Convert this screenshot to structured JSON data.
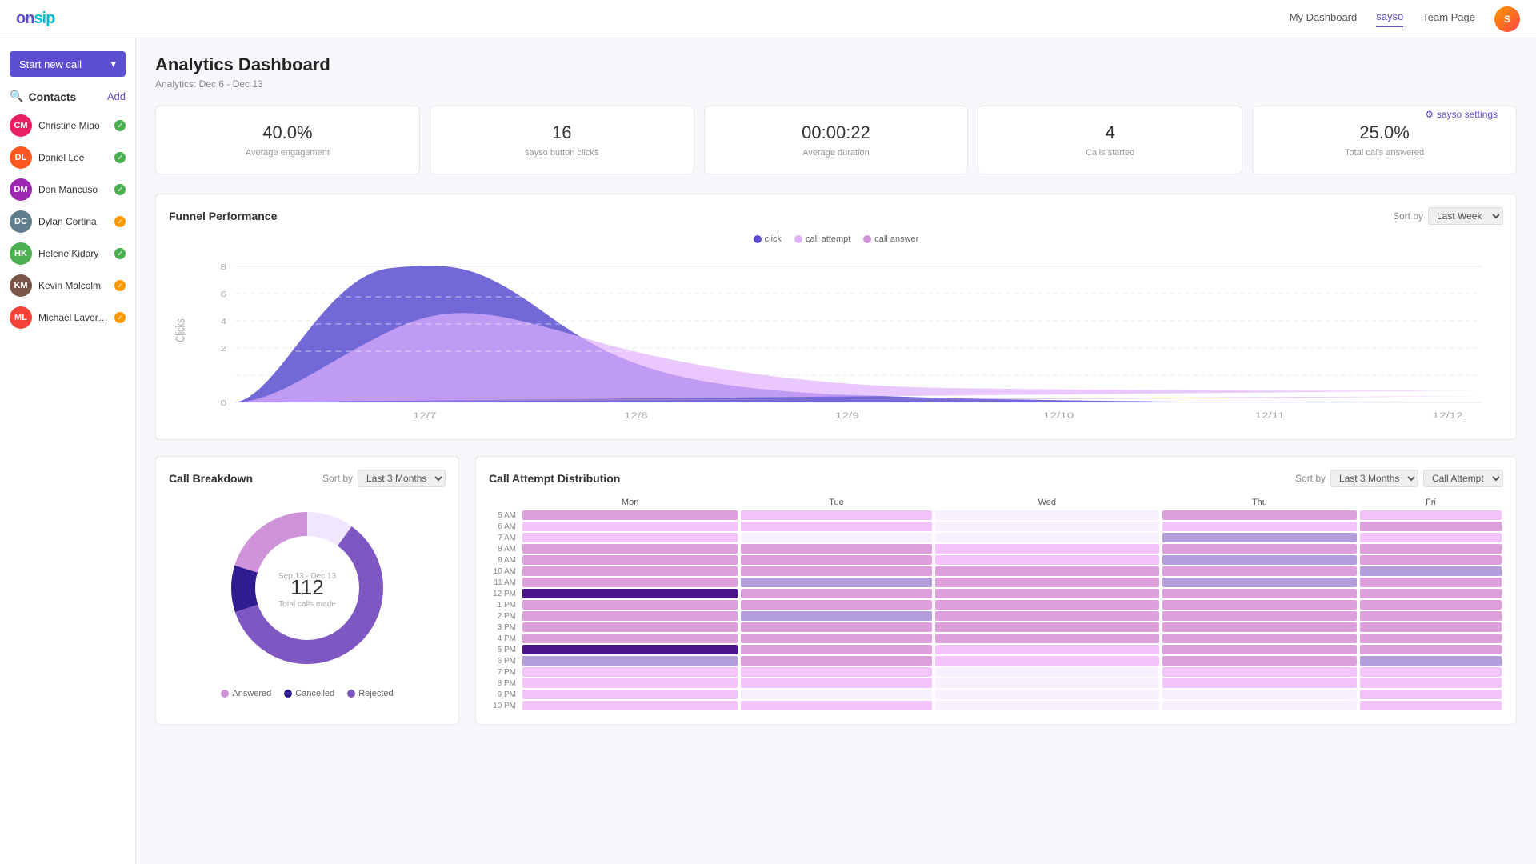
{
  "nav": {
    "logo": "onsip",
    "links": [
      {
        "label": "My Dashboard",
        "active": false
      },
      {
        "label": "sayso",
        "active": true
      },
      {
        "label": "Team Page",
        "active": false
      }
    ],
    "avatar_initials": "S"
  },
  "sidebar": {
    "start_call": "Start new call",
    "contacts_label": "Contacts",
    "add_label": "Add",
    "contacts": [
      {
        "name": "Christine Miao",
        "color": "#e91e63",
        "status": "green"
      },
      {
        "name": "Daniel Lee",
        "color": "#ff5722",
        "status": "green"
      },
      {
        "name": "Don Mancuso",
        "color": "#9c27b0",
        "status": "green"
      },
      {
        "name": "Dylan Cortina",
        "color": "#607d8b",
        "status": "orange"
      },
      {
        "name": "Helene Kidary",
        "color": "#4caf50",
        "status": "green"
      },
      {
        "name": "Kevin Malcolm",
        "color": "#795548",
        "status": "orange"
      },
      {
        "name": "Michael Lavorgna",
        "color": "#f44336",
        "status": "orange"
      }
    ]
  },
  "header": {
    "title": "Analytics Dashboard",
    "subtitle": "Analytics: Dec 6 - Dec 13",
    "settings_label": "sayso settings"
  },
  "stats": [
    {
      "value": "40.0%",
      "label": "Average engagement"
    },
    {
      "value": "16",
      "label": "sayso button clicks"
    },
    {
      "value": "00:00:22",
      "label": "Average duration"
    },
    {
      "value": "4",
      "label": "Calls started"
    },
    {
      "value": "25.0%",
      "label": "Total calls answered"
    }
  ],
  "funnel": {
    "title": "Funnel Performance",
    "sort_label": "Sort by",
    "sort_value": "Last Week",
    "clicks_axis": "Clicks",
    "legend": [
      {
        "label": "click",
        "color": "#5b4fcf"
      },
      {
        "label": "call attempt",
        "color": "#e0b0ff"
      },
      {
        "label": "call answer",
        "color": "#ce93d8"
      }
    ],
    "x_labels": [
      "12/7",
      "12/8",
      "12/9",
      "12/10",
      "12/11",
      "12/12"
    ],
    "y_labels": [
      "8",
      "6",
      "4",
      "2",
      "0"
    ]
  },
  "call_breakdown": {
    "title": "Call Breakdown",
    "sort_label": "Sort by",
    "sort_value": "Last 3 Months",
    "date_range": "Sep 13 - Dec 13",
    "total_value": "112",
    "total_label": "Total calls made",
    "legend": [
      {
        "label": "Answered",
        "color": "#ce93d8"
      },
      {
        "label": "Cancelled",
        "color": "#311b92"
      },
      {
        "label": "Rejected",
        "color": "#7e57c2"
      }
    ]
  },
  "call_attempt": {
    "title": "Call Attempt Distribution",
    "sort_label": "Sort by",
    "sort_value": "Last 3 Months",
    "sort_value2": "Call Attempt",
    "days": [
      "Mon",
      "Tue",
      "Wed",
      "Thu",
      "Fri"
    ],
    "times": [
      "5 AM",
      "6 AM",
      "7 AM",
      "8 AM",
      "9 AM",
      "10 AM",
      "11 AM",
      "12 PM",
      "1 PM",
      "2 PM",
      "3 PM",
      "4 PM",
      "5 PM",
      "6 PM",
      "7 PM",
      "8 PM",
      "9 PM",
      "10 PM"
    ],
    "heat_data": [
      [
        2,
        1,
        0,
        2,
        1
      ],
      [
        1,
        1,
        0,
        1,
        2
      ],
      [
        1,
        0,
        0,
        3,
        1
      ],
      [
        2,
        2,
        1,
        2,
        2
      ],
      [
        2,
        2,
        1,
        3,
        2
      ],
      [
        2,
        2,
        2,
        2,
        3
      ],
      [
        2,
        3,
        2,
        3,
        2
      ],
      [
        4,
        2,
        2,
        2,
        2
      ],
      [
        2,
        2,
        2,
        2,
        2
      ],
      [
        2,
        3,
        2,
        2,
        2
      ],
      [
        2,
        2,
        2,
        2,
        2
      ],
      [
        2,
        2,
        2,
        2,
        2
      ],
      [
        4,
        2,
        1,
        2,
        2
      ],
      [
        3,
        2,
        1,
        2,
        3
      ],
      [
        1,
        1,
        0,
        1,
        1
      ],
      [
        1,
        1,
        0,
        1,
        1
      ],
      [
        1,
        0,
        0,
        0,
        1
      ],
      [
        1,
        1,
        0,
        0,
        1
      ]
    ]
  }
}
